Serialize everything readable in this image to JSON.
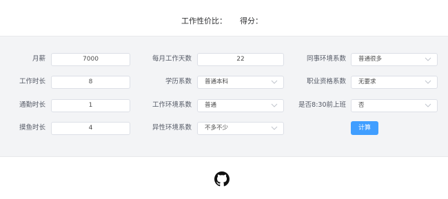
{
  "header": {
    "title": "工作性价比：",
    "score_label": "得分："
  },
  "form": {
    "col1": [
      {
        "label": "月薪",
        "value": "7000"
      },
      {
        "label": "工作时长",
        "value": "8"
      },
      {
        "label": "通勤时长",
        "value": "1"
      },
      {
        "label": "摸鱼时长",
        "value": "4"
      }
    ],
    "col2": [
      {
        "label": "每月工作天数",
        "value": "22",
        "type": "input"
      },
      {
        "label": "学历系数",
        "value": "普通本科",
        "type": "select"
      },
      {
        "label": "工作环境系数",
        "value": "普通",
        "type": "select"
      },
      {
        "label": "异性环境系数",
        "value": "不多不少",
        "type": "select"
      }
    ],
    "col3": [
      {
        "label": "同事环境系数",
        "value": "普通很多"
      },
      {
        "label": "职业资格系数",
        "value": "无要求"
      },
      {
        "label": "是否8:30前上班",
        "value": "否"
      }
    ],
    "submit_label": "计算"
  },
  "footer": {
    "icon": "github-icon"
  },
  "colors": {
    "accent": "#409eff",
    "panel_bg": "#f3f4f6"
  }
}
